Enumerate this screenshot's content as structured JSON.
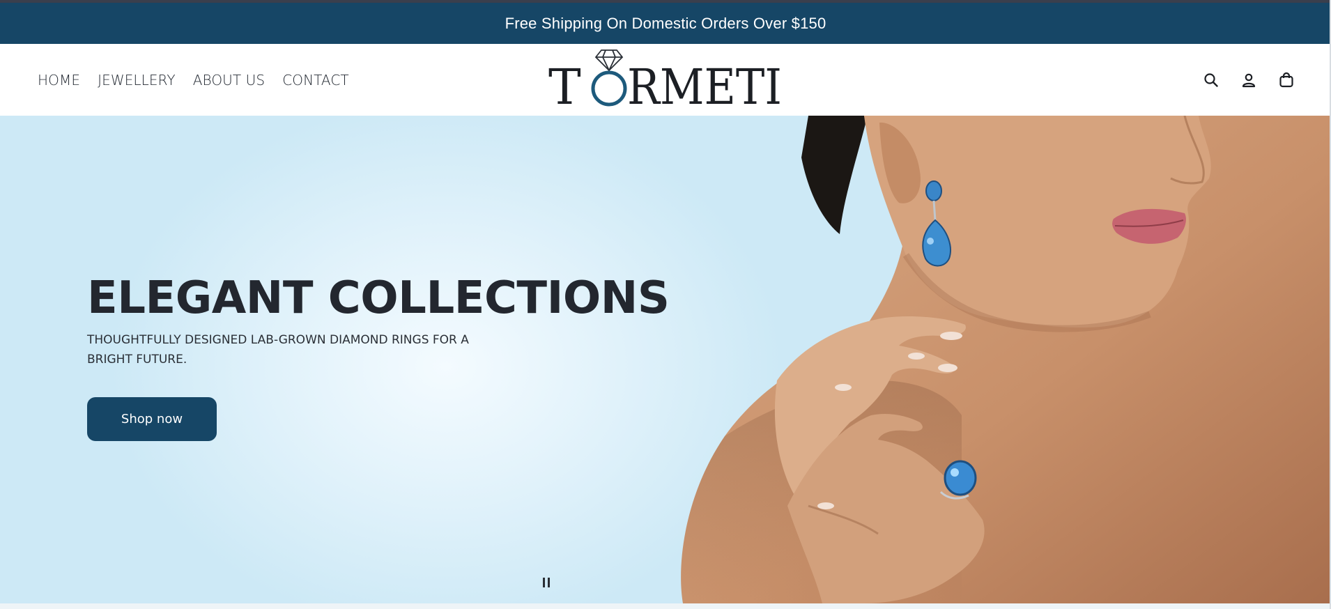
{
  "announcement": {
    "text": "Free Shipping On Domestic Orders Over $150"
  },
  "nav": {
    "items": [
      {
        "label": "HOME"
      },
      {
        "label": "JEWELLERY"
      },
      {
        "label": "ABOUT US"
      },
      {
        "label": "CONTACT"
      }
    ]
  },
  "brand": {
    "name": "TORMETI",
    "letters_after_ring": "RMETI",
    "first_letter": "T"
  },
  "header_icons": [
    "search-icon",
    "account-icon",
    "cart-icon"
  ],
  "hero": {
    "title": "ELEGANT COLLECTIONS",
    "subtitle": "THOUGHTFULLY DESIGNED LAB-GROWN DIAMOND RINGS FOR A BRIGHT FUTURE.",
    "cta_label": "Shop now"
  },
  "slideshow": {
    "control": "pause-icon"
  },
  "colors": {
    "brand_navy": "#164666",
    "hero_bg": "#d6eef8",
    "text_dark": "#23272f"
  }
}
